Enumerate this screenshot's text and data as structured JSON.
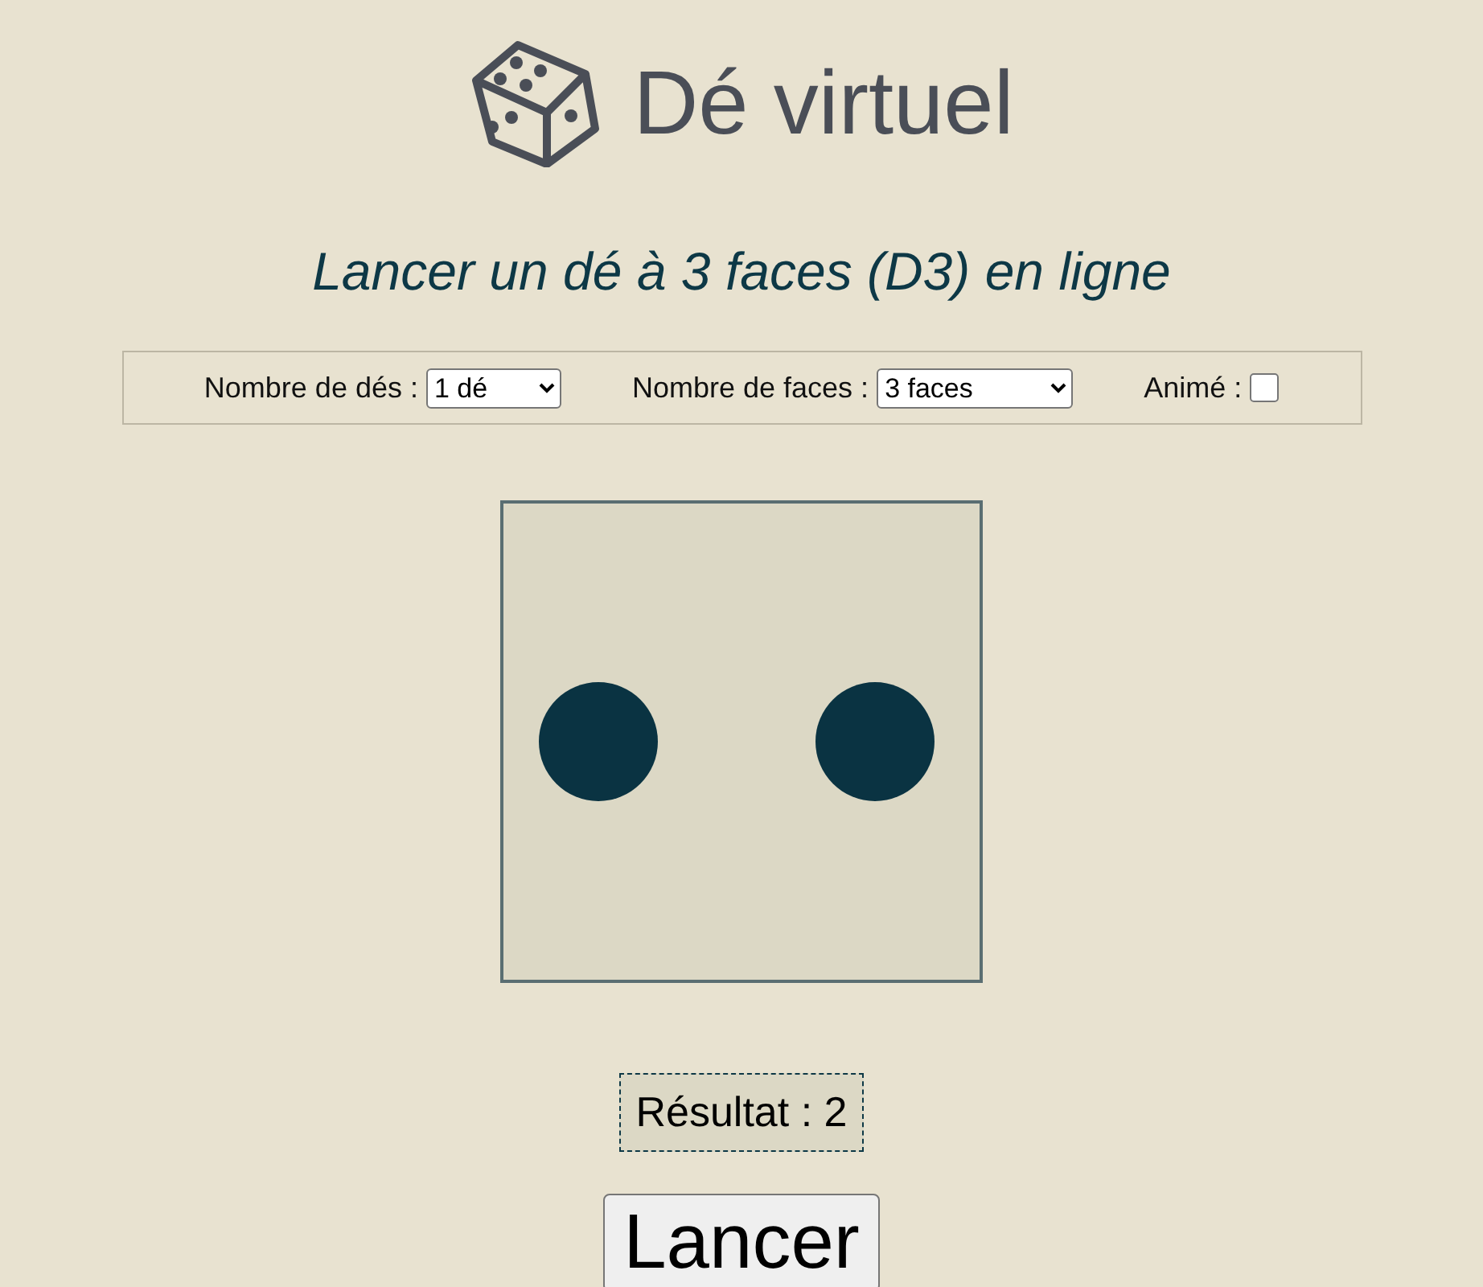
{
  "header": {
    "title": "Dé virtuel",
    "subtitle": "Lancer un dé à 3 faces (D3) en ligne"
  },
  "controls": [
    {
      "kind": "select",
      "label": "Nombre de dés :",
      "value": "1 dé"
    },
    {
      "kind": "select",
      "label": "Nombre de faces :",
      "value": "3 faces"
    },
    {
      "kind": "checkbox",
      "label": "Animé :",
      "checked": false
    }
  ],
  "die": {
    "kind": "two"
  },
  "result": "Résultat : 2",
  "roll_button": "Lancer"
}
